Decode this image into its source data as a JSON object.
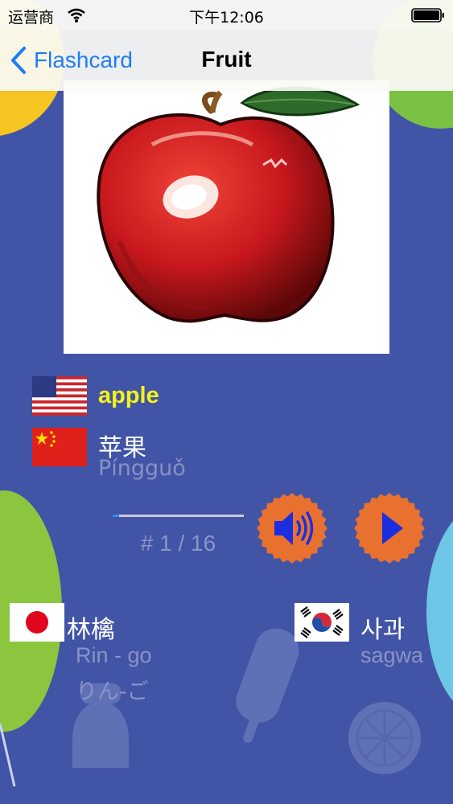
{
  "status_bar": {
    "carrier": "运营商",
    "time": "下午12:06"
  },
  "nav": {
    "back_label": "Flashcard",
    "title": "Fruit"
  },
  "card": {
    "image_icon": "apple-illustration",
    "english": {
      "flag_icon": "us-flag-icon",
      "word": "apple"
    },
    "chinese": {
      "flag_icon": "china-flag-icon",
      "word": "苹果",
      "romanization": "Píngguǒ"
    },
    "japanese": {
      "flag_icon": "japan-flag-icon",
      "word": "林檎",
      "romanization": "Rin - go",
      "kana": "りん-ご"
    },
    "korean": {
      "flag_icon": "korea-flag-icon",
      "word": "사과",
      "romanization": "sagwa"
    }
  },
  "player": {
    "progress": 0.05,
    "counter": "# 1 / 16",
    "speaker_icon": "speaker-icon",
    "play_icon": "play-icon"
  },
  "colors": {
    "background": "#4254a6",
    "accent_blue": "#1f7cf5",
    "english_word": "#f3f31b",
    "button_orange": "#e8712f",
    "button_glyph": "#1b2fe0",
    "muted_text": "#8b95c9"
  }
}
